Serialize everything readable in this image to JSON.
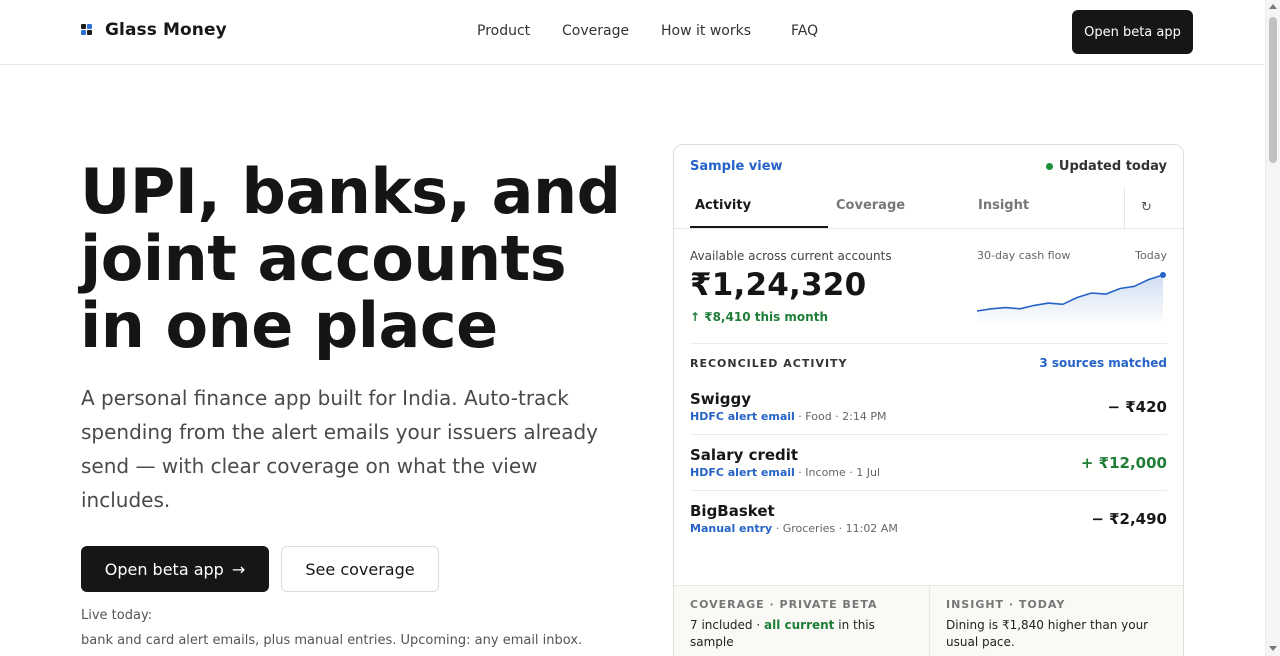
{
  "header": {
    "brand": "Glass Money",
    "nav": [
      "Product",
      "Coverage",
      "How it works",
      "FAQ"
    ],
    "cta": "Open beta app"
  },
  "hero": {
    "title_lines": [
      "UPI, banks, and",
      "joint accounts",
      "in one place"
    ],
    "subtitle": "A personal finance app built for India. Auto-track spending from the alert emails your issuers already send — with clear coverage on what the view includes.",
    "primary_button": "Open beta app",
    "primary_arrow": "→",
    "secondary_button": "See coverage",
    "live_label": "Live today:",
    "live_text": "bank and card alert emails, plus manual entries. Upcoming: any email inbox."
  },
  "card": {
    "sample_label": "Sample view",
    "status": "Updated today",
    "status_color": "#1b8f3a",
    "tabs": [
      "Activity",
      "Coverage",
      "Insight"
    ],
    "active_tab": "Activity",
    "refresh_icon": "↻",
    "balance_label": "Available across current accounts",
    "balance": "₹1,24,320",
    "delta": "↑ ₹8,410 this month",
    "flow_label": "30-day cash flow",
    "flow_end_label": "Today",
    "flow_series": [
      10,
      12,
      13,
      12,
      15,
      17,
      16,
      22,
      26,
      25,
      30,
      32,
      38,
      42
    ],
    "reconciled_label": "RECONCILED ACTIVITY",
    "matched": "3 sources matched",
    "transactions": [
      {
        "name": "Swiggy",
        "source": "HDFC alert email",
        "rest": " · Food · 2:14 PM",
        "amount": "− ₹420",
        "positive": false
      },
      {
        "name": "Salary credit",
        "source": "HDFC alert email",
        "rest": " · Income · 1 Jul",
        "amount": "+ ₹12,000",
        "positive": true
      },
      {
        "name": "BigBasket",
        "source": "Manual entry",
        "rest": " · Groceries · 11:02 AM",
        "amount": "− ₹2,490",
        "positive": false
      }
    ],
    "coverage_head": "COVERAGE · PRIVATE BETA",
    "coverage_pre": "7 included · ",
    "coverage_hl": "all current",
    "coverage_post": " in this sample",
    "insight_head": "INSIGHT · TODAY",
    "insight_body": "Dining is ₹1,840 higher than your usual pace."
  },
  "colors": {
    "accent_blue": "#2563c9",
    "positive_green": "#1e7d39",
    "dark_button": "#161616"
  }
}
